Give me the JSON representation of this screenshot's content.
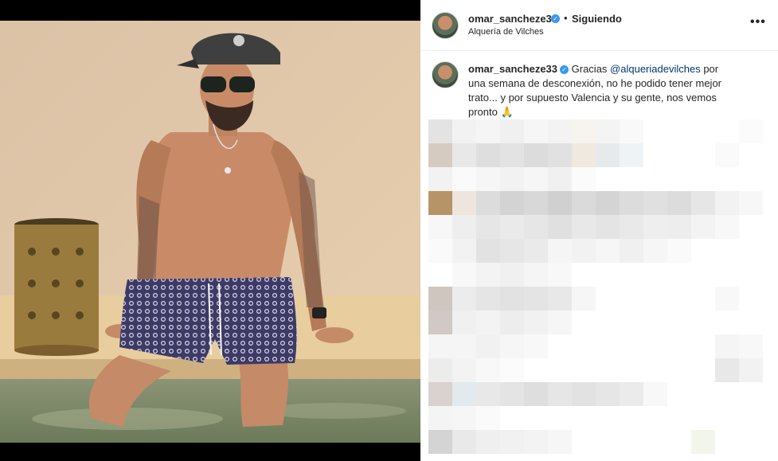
{
  "post": {
    "username": "omar_sanchezе33",
    "follow_label": "Siguiendo",
    "separator": "•",
    "location": "Alquería de Vilches",
    "more_label": "•••",
    "verified_glyph": "✓"
  },
  "caption": {
    "username": "omar_sanchezе33",
    "text_before": "Gracias ",
    "mention": "@alqueriadevilches",
    "text_after": " por una semana de desconexión, no he podido tener mejor trato... y por supuesto Valencia y su gente, nos vemos pronto 🙏"
  },
  "colors": {
    "link": "#00376b",
    "verified": "#3897f0",
    "text": "#262626"
  }
}
